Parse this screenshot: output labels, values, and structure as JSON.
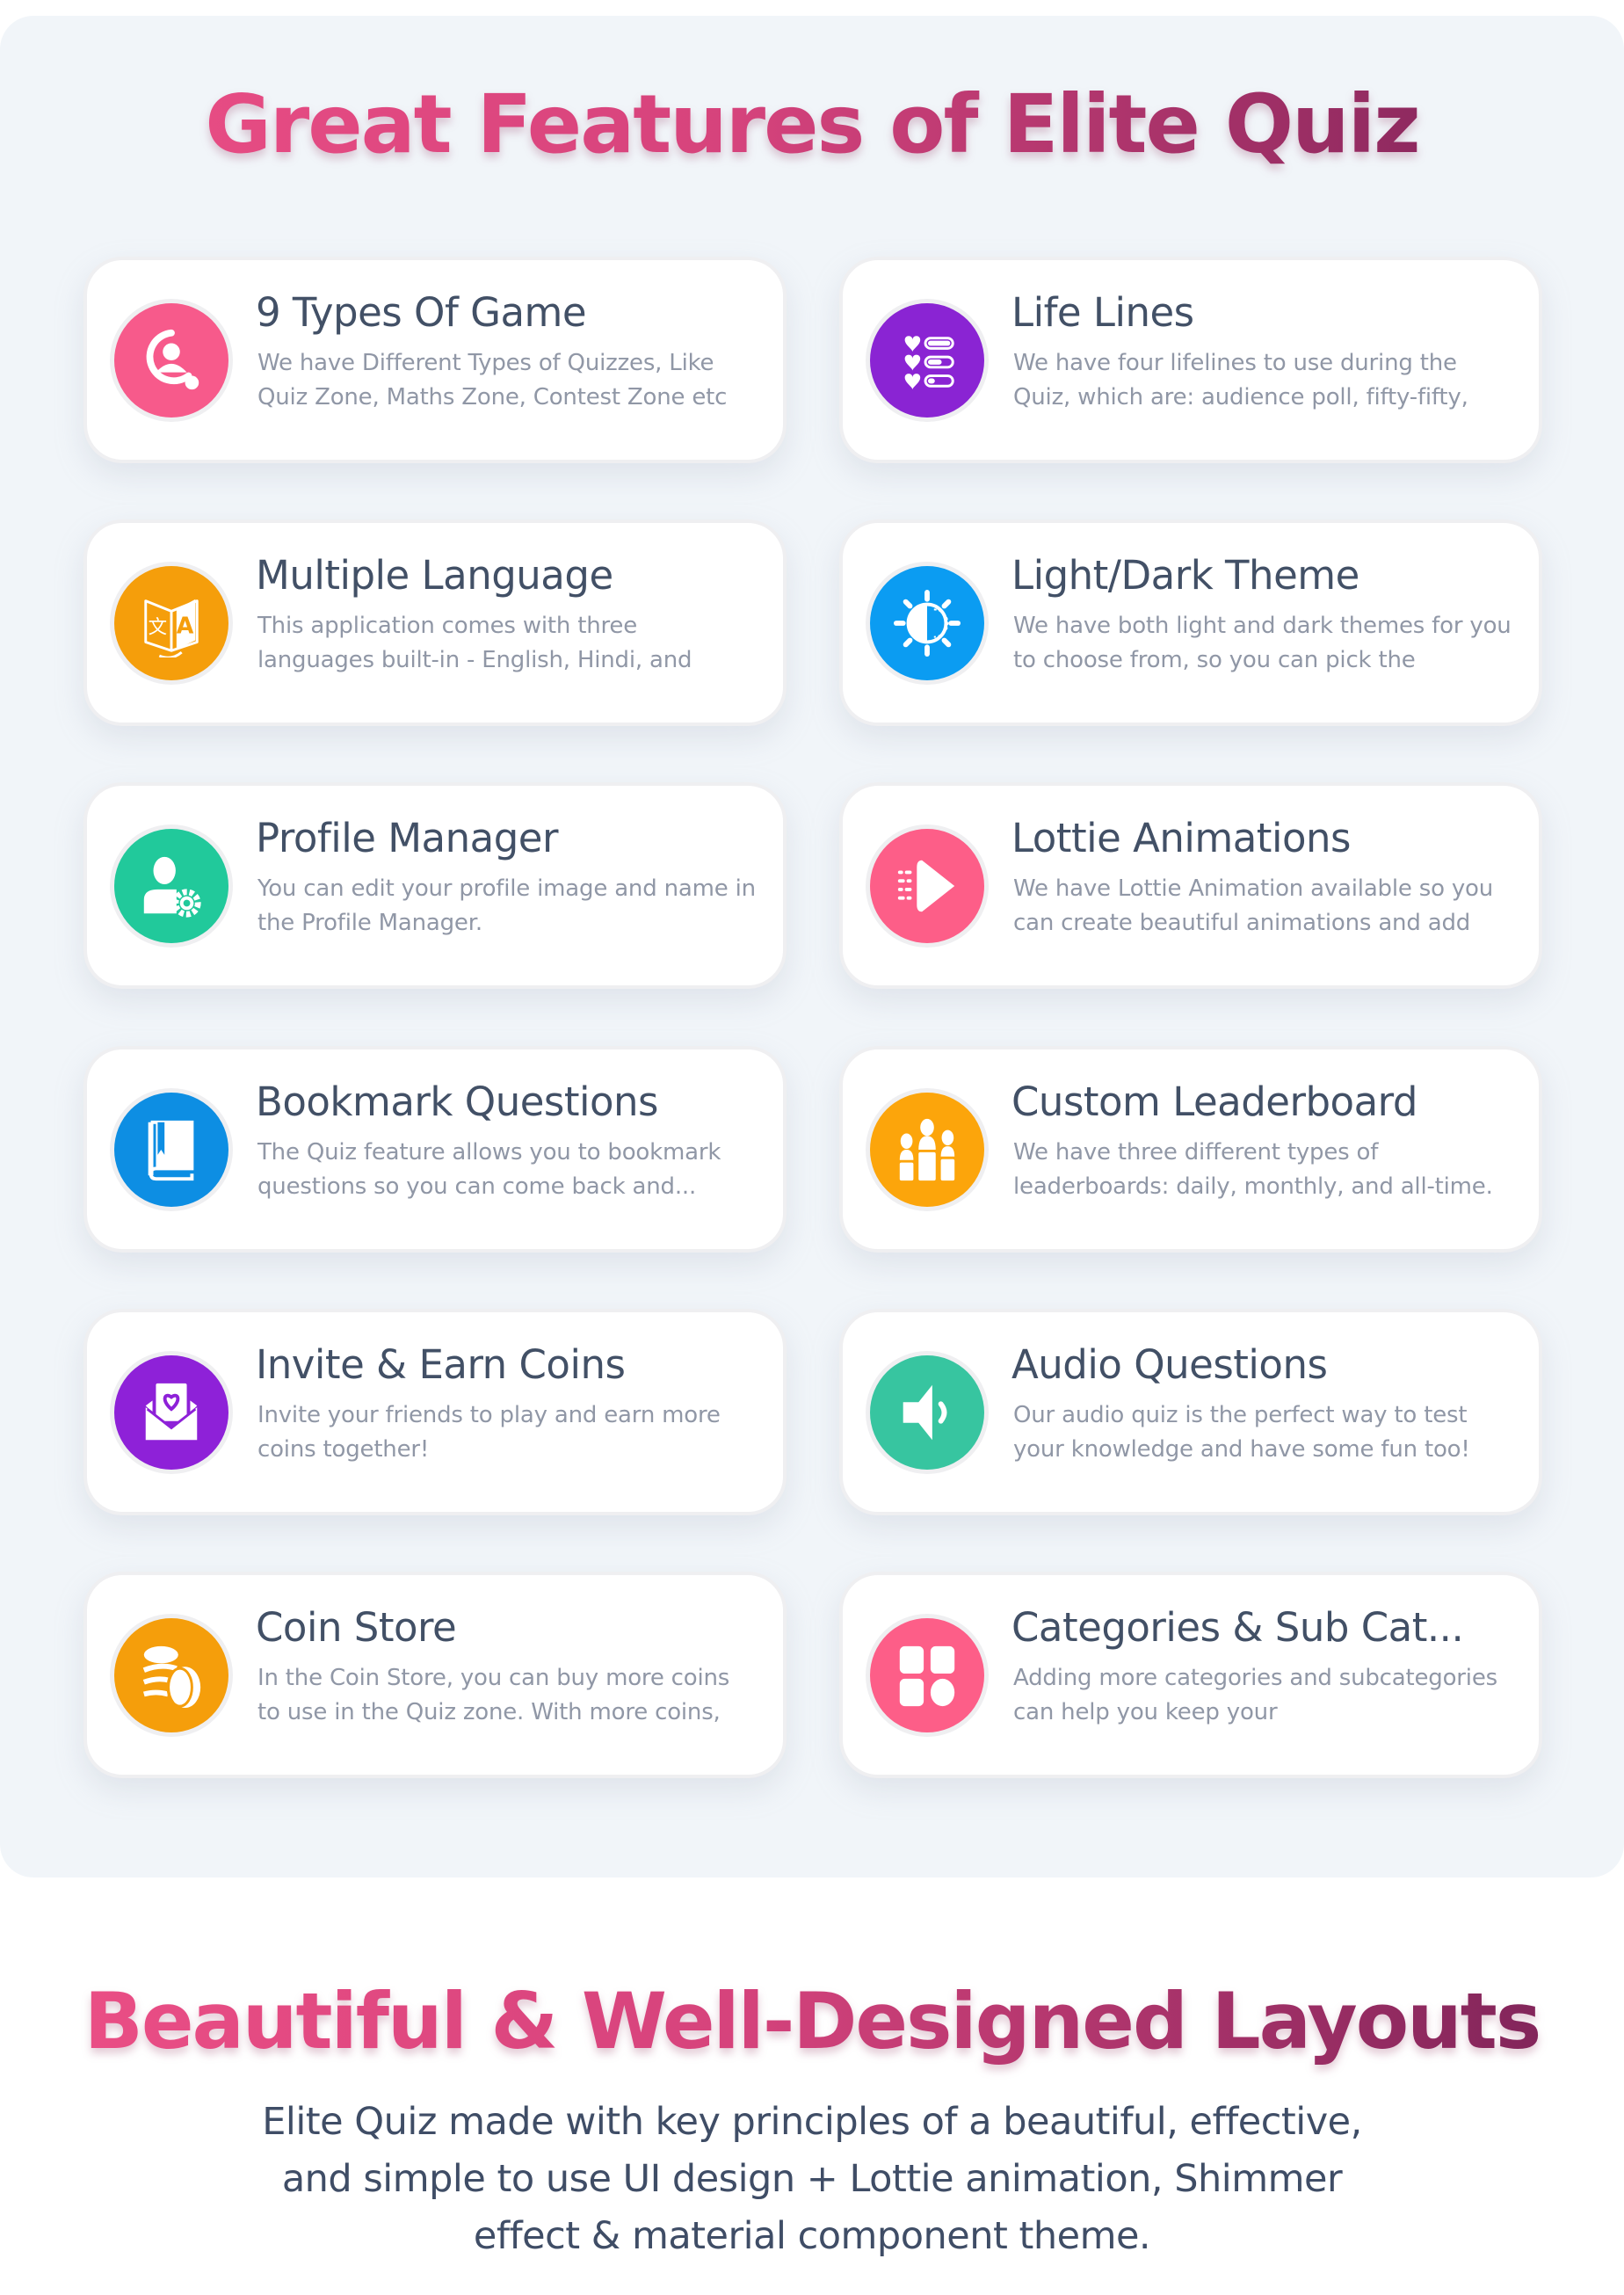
{
  "section_features": {
    "title": "Great Features of Elite Quiz",
    "features": [
      {
        "title": "9 Types Of Game",
        "desc": "We have Different Types of Quizzes, Like Quiz Zone, Maths Zone, Contest Zone etc",
        "icon": "quiz-search-icon",
        "color": "#f75a8b"
      },
      {
        "title": "Life Lines",
        "desc": "We have four lifelines to use during the Quiz, which are: audience poll, fifty-fifty,",
        "icon": "lifelines-hearts-icon",
        "color": "#8a24d3"
      },
      {
        "title": "Multiple Language",
        "desc": "This application comes with three languages built-in - English, Hindi, and",
        "icon": "translate-icon",
        "color": "#f59e0b"
      },
      {
        "title": "Light/Dark Theme",
        "desc": "We have both light and dark themes for you to choose from, so you can pick the",
        "icon": "theme-sun-icon",
        "color": "#0b9cf2"
      },
      {
        "title": "Profile Manager",
        "desc": "You can edit your profile image and name in the Profile Manager.",
        "icon": "user-settings-icon",
        "color": "#21c99b"
      },
      {
        "title": "Lottie Animations",
        "desc": "We have Lottie Animation available so you can create beautiful animations and add",
        "icon": "play-animation-icon",
        "color": "#fd5e88"
      },
      {
        "title": "Bookmark Questions",
        "desc": "The Quiz feature allows you to bookmark questions so you can come back and...",
        "icon": "bookmark-book-icon",
        "color": "#0d8ee3"
      },
      {
        "title": "Custom Leaderboard",
        "desc": "We have three different types of leaderboards: daily, monthly, and all-time.",
        "icon": "leaderboard-icon",
        "color": "#fca50b"
      },
      {
        "title": "Invite & Earn Coins",
        "desc": "Invite your friends to play and earn more coins together!",
        "icon": "invite-envelope-icon",
        "color": "#8e21d8"
      },
      {
        "title": "Audio Questions",
        "desc": "Our audio quiz is the perfect way to test your knowledge and have some fun too!",
        "icon": "speaker-icon",
        "color": "#37c5a0"
      },
      {
        "title": "Coin Store",
        "desc": "In the Coin Store, you can buy more coins to use in the Quiz zone. With more coins,",
        "icon": "coins-icon",
        "color": "#f59e0b"
      },
      {
        "title": "Categories & Sub Cat...",
        "desc": "Adding more categories and subcategories can help you keep your",
        "icon": "categories-grid-icon",
        "color": "#fd5e88"
      }
    ]
  },
  "section_layouts": {
    "title": "Beautiful & Well-Designed Layouts",
    "subtitle_lines": [
      "Elite Quiz made with key principles of a beautiful, effective,",
      "and simple to use UI design + Lottie animation, Shimmer",
      "effect & material component theme."
    ]
  }
}
